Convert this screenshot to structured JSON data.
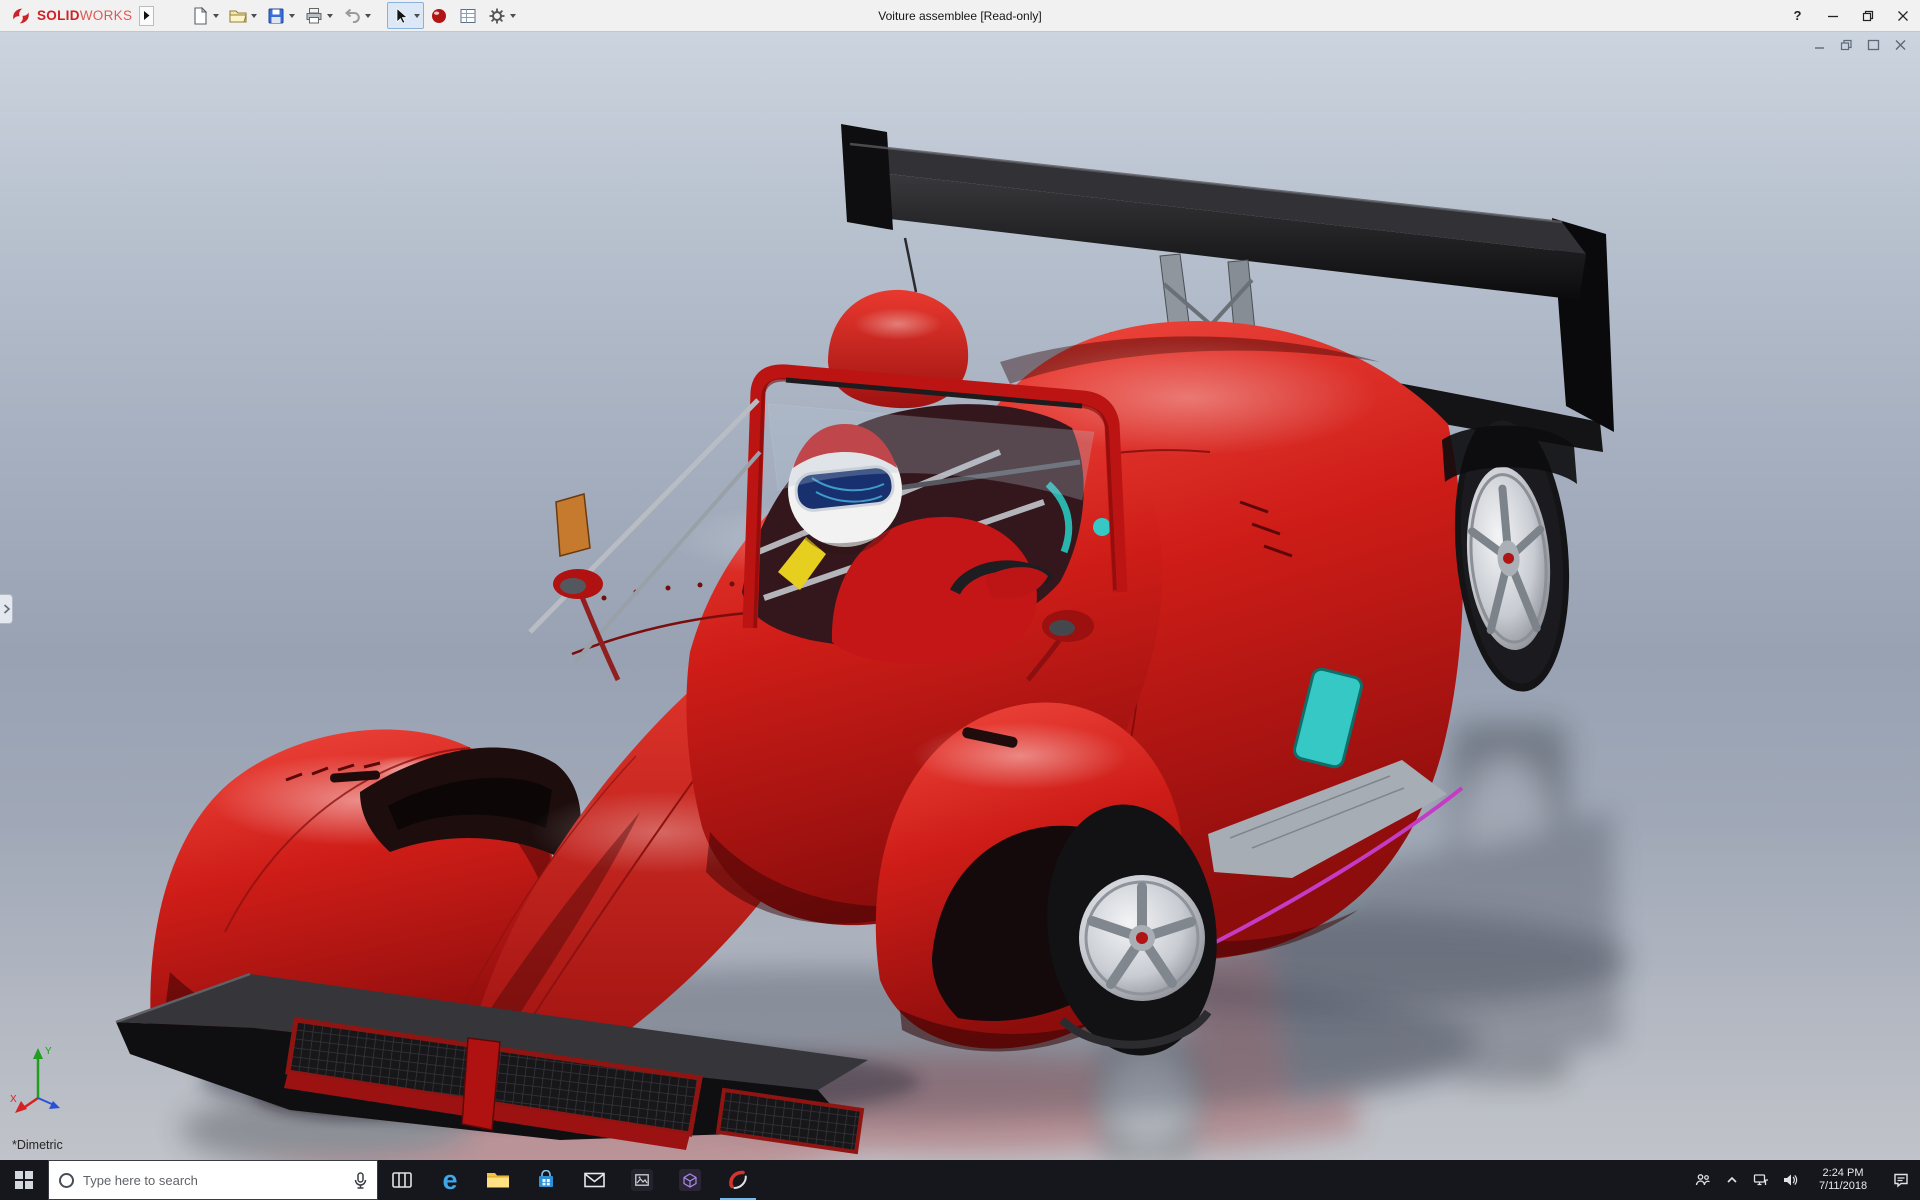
{
  "colors": {
    "brand_red": "#cf2127",
    "titlebar_bg": "#f1f1f1",
    "taskbar_bg": "#16161d",
    "car_red": "#cf1d18",
    "wing_black": "#101012",
    "accent_teal": "#35c8c4",
    "accent_yellow": "#e6cf1e",
    "accent_magenta": "#c33cc3",
    "viewport_top": "#ccd4df",
    "viewport_mid": "#98a2b3",
    "viewport_bottom": "#c0c3c9"
  },
  "titlebar": {
    "brand_solid": "SOLID",
    "brand_works": "WORKS",
    "title": "Voiture assemblee [Read-only]",
    "help_label": "?"
  },
  "toolbar": {
    "buttons": [
      {
        "name": "new-document"
      },
      {
        "name": "open"
      },
      {
        "name": "save"
      },
      {
        "name": "print"
      },
      {
        "name": "undo"
      },
      {
        "name": "select"
      },
      {
        "name": "appearance-sphere"
      },
      {
        "name": "drawing-sheet"
      },
      {
        "name": "options-gear"
      }
    ]
  },
  "viewport": {
    "view_label": "*Dimetric",
    "triad": {
      "x": "X",
      "y": "Y"
    }
  },
  "taskbar": {
    "search_placeholder": "Type here to search",
    "edge_glyph": "e",
    "clock": {
      "time": "2:24 PM",
      "date": "7/11/2018"
    }
  }
}
